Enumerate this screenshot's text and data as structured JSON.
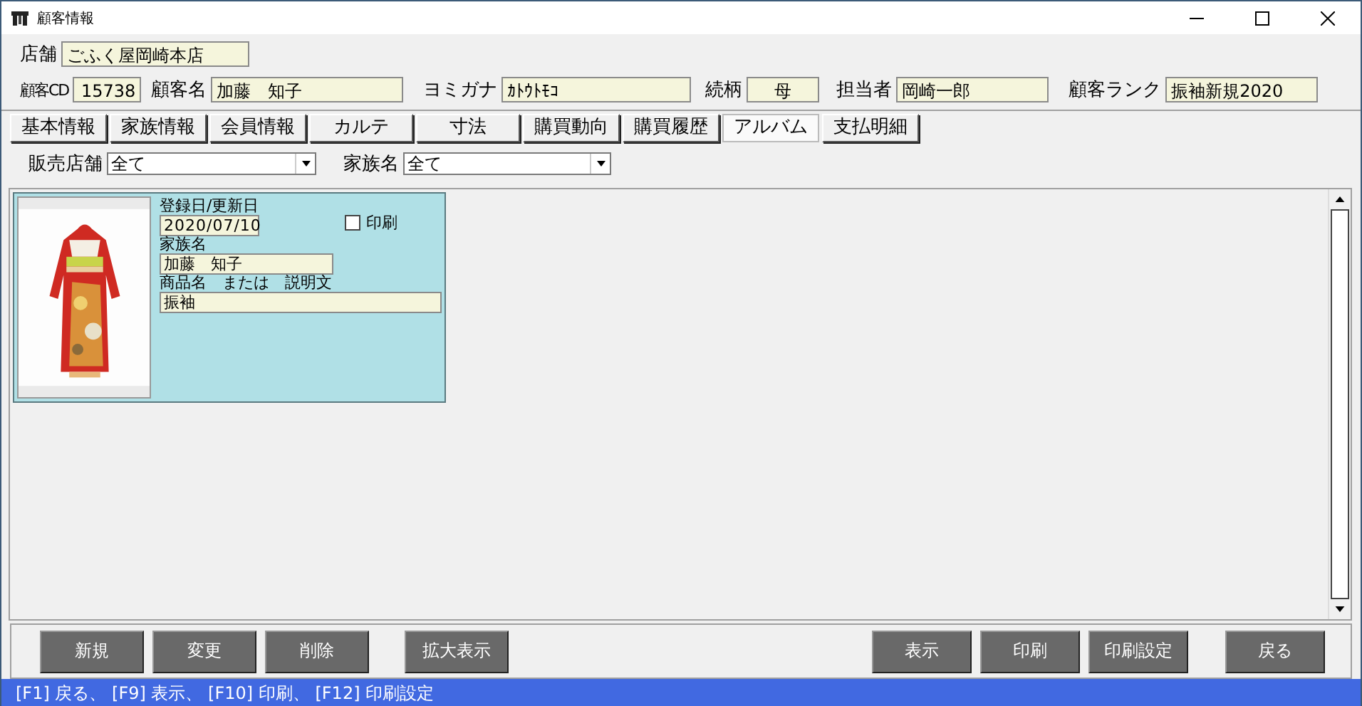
{
  "window": {
    "title": "顧客情報"
  },
  "header": {
    "store_label": "店舗",
    "store": "ごふく屋岡崎本店",
    "fields": [
      {
        "label": "顧客CD",
        "value": "15738"
      },
      {
        "label": "顧客名",
        "value": "加藤　知子"
      },
      {
        "label": "ヨミガナ",
        "value": "ｶﾄｳﾄﾓｺ"
      },
      {
        "label": "続柄",
        "value": "母"
      },
      {
        "label": "担当者",
        "value": "岡崎一郎"
      },
      {
        "label": "顧客ランク",
        "value": "振袖新規2020"
      }
    ]
  },
  "tabs": [
    {
      "label": "基本情報",
      "selected": false
    },
    {
      "label": "家族情報",
      "selected": false
    },
    {
      "label": "会員情報",
      "selected": false
    },
    {
      "label": "カルテ",
      "selected": false
    },
    {
      "label": "寸法",
      "selected": false
    },
    {
      "label": "購買動向",
      "selected": false
    },
    {
      "label": "購買履歴",
      "selected": false
    },
    {
      "label": "アルバム",
      "selected": true
    },
    {
      "label": "支払明細",
      "selected": false
    }
  ],
  "filters": [
    {
      "label": "販売店舗",
      "value": "全て"
    },
    {
      "label": "家族名",
      "value": "全て"
    }
  ],
  "album": [
    {
      "kind": "picture",
      "date_label": "登録日/更新日",
      "date": "2020/07/10",
      "print_label": "印刷",
      "print_checked": false,
      "family_label": "家族名",
      "family": "加藤　知子",
      "item_label": "商品名　または　説明文",
      "item": "振袖"
    }
  ],
  "buttons": {
    "left": [
      "新規",
      "変更",
      "削除",
      "拡大表示"
    ],
    "right": [
      "表示",
      "印刷",
      "印刷設定",
      "戻る"
    ]
  },
  "status_bar": "[F1] 戻る、 [F9] 表示、 [F10] 印刷、 [F12] 印刷設定"
}
